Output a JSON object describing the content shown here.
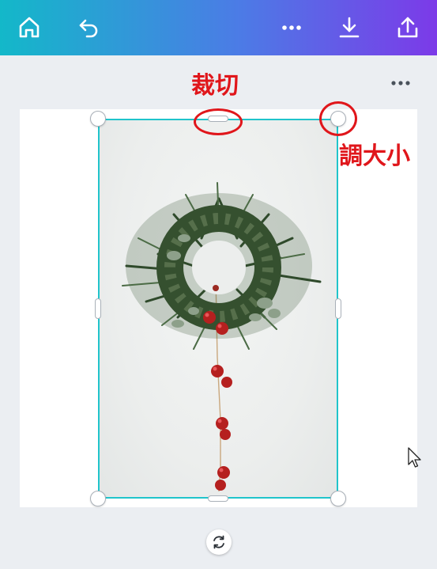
{
  "topbar": {
    "icons": [
      "home-icon",
      "undo-icon",
      "more-icon",
      "download-icon",
      "share-icon"
    ]
  },
  "page_menu": {
    "icon": "more-icon"
  },
  "annotations": {
    "crop_label": "裁切",
    "resize_label": "調大小",
    "color": "#e0161b"
  },
  "image": {
    "subject": "wreath-photo"
  },
  "controls": {
    "rotate_icon": "rotate-icon"
  },
  "colors": {
    "gradient_start": "#13b8c9",
    "gradient_end": "#7c3ae8",
    "selection": "#20c4cb",
    "canvas_bg": "#ebeef2"
  }
}
